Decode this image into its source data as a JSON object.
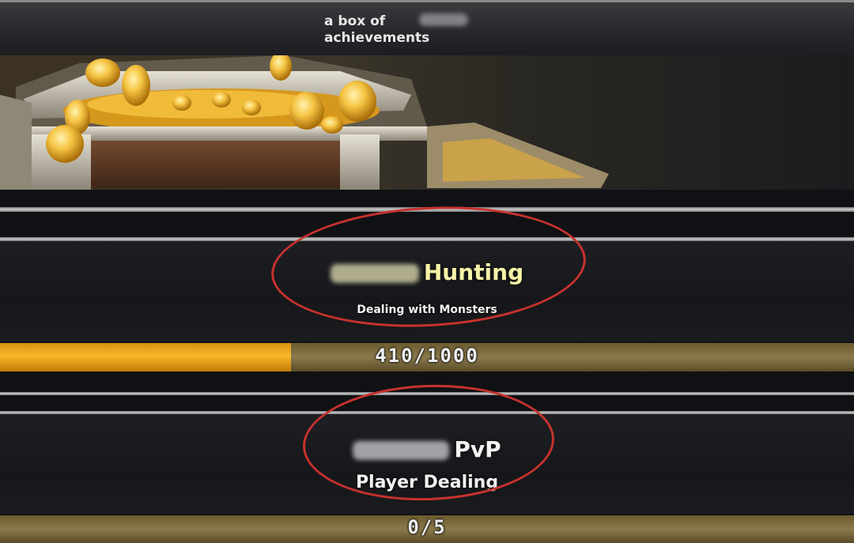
{
  "header": {
    "title": "a box of\nachievements"
  },
  "achievements": [
    {
      "title": "Hunting",
      "subtitle": "Dealing with Monsters",
      "progress_text": "410/1000",
      "current": 410,
      "goal": 1000
    },
    {
      "title": "PvP",
      "subtitle": "Player Dealing",
      "progress_text": "0/5",
      "current": 0,
      "goal": 5
    }
  ],
  "colors": {
    "title": "#f6f3a8",
    "progress_fill": "#f8b82a",
    "annotation": "#c7322e"
  },
  "icons": [
    "treasure-chest-image",
    "gold-coin-icon"
  ]
}
